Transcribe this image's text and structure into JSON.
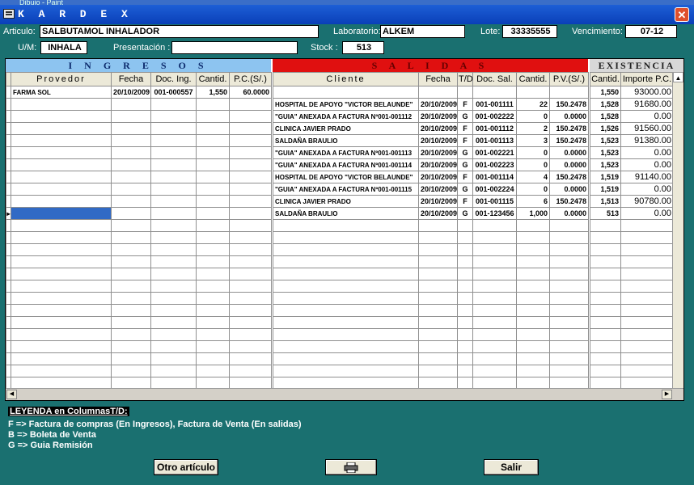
{
  "window": {
    "outer_title": "Dibujo - Paint",
    "title": "K A R D E X",
    "close_glyph": "✕"
  },
  "fields": {
    "articulo_label": "Articulo:",
    "articulo": "SALBUTAMOL INHALADOR",
    "laboratorio_label": "Laboratorio:",
    "laboratorio": "ALKEM",
    "lote_label": "Lote:",
    "lote": "33335555",
    "vencimiento_label": "Vencimiento:",
    "vencimiento": "07-12",
    "um_label": "U/M:",
    "um": "INHALA",
    "presentacion_label": "Presentación :",
    "presentacion": "",
    "stock_label": "Stock :",
    "stock": "513"
  },
  "sections": {
    "ingresos": "I N G R E S O S",
    "salidas": "S A L I D A S",
    "existencia": "EXISTENCIA"
  },
  "columns": {
    "ingresos": [
      "Provedor",
      "Fecha",
      "Doc. Ing.",
      "Cantid.",
      "P.C.(S/.)"
    ],
    "salidas": [
      "Cliente",
      "Fecha",
      "T/D",
      "Doc. Sal.",
      "Cantid.",
      "P.V.(S/.)"
    ],
    "existencia": [
      "Cantid.",
      "Importe P.C."
    ]
  },
  "rows": [
    {
      "ing": [
        "FARMA SOL",
        "20/10/2009",
        "001-000557",
        "1,550",
        "60.0000"
      ],
      "sal": [
        "",
        "",
        "",
        "",
        "",
        ""
      ],
      "exi": [
        "1,550",
        "93000.00"
      ]
    },
    {
      "ing": [
        "",
        "",
        "",
        "",
        ""
      ],
      "sal": [
        "HOSPITAL DE APOYO \"VICTOR BELAUNDE\"",
        "20/10/2009",
        "F",
        "001-001111",
        "22",
        "150.2478"
      ],
      "exi": [
        "1,528",
        "91680.00"
      ]
    },
    {
      "ing": [
        "",
        "",
        "",
        "",
        ""
      ],
      "sal": [
        "\"GUIA\" ANEXADA A FACTURA Nº001-001112",
        "20/10/2009",
        "G",
        "001-002222",
        "0",
        "0.0000"
      ],
      "exi": [
        "1,528",
        "0.00"
      ]
    },
    {
      "ing": [
        "",
        "",
        "",
        "",
        ""
      ],
      "sal": [
        "CLINICA JAVIER PRADO",
        "20/10/2009",
        "F",
        "001-001112",
        "2",
        "150.2478"
      ],
      "exi": [
        "1,526",
        "91560.00"
      ]
    },
    {
      "ing": [
        "",
        "",
        "",
        "",
        ""
      ],
      "sal": [
        "SALDAÑA BRAULIO",
        "20/10/2009",
        "F",
        "001-001113",
        "3",
        "150.2478"
      ],
      "exi": [
        "1,523",
        "91380.00"
      ]
    },
    {
      "ing": [
        "",
        "",
        "",
        "",
        ""
      ],
      "sal": [
        "\"GUIA\" ANEXADA A FACTURA Nº001-001113",
        "20/10/2009",
        "G",
        "001-002221",
        "0",
        "0.0000"
      ],
      "exi": [
        "1,523",
        "0.00"
      ]
    },
    {
      "ing": [
        "",
        "",
        "",
        "",
        ""
      ],
      "sal": [
        "\"GUIA\" ANEXADA A FACTURA Nº001-001114",
        "20/10/2009",
        "G",
        "001-002223",
        "0",
        "0.0000"
      ],
      "exi": [
        "1,523",
        "0.00"
      ]
    },
    {
      "ing": [
        "",
        "",
        "",
        "",
        ""
      ],
      "sal": [
        "HOSPITAL DE APOYO \"VICTOR BELAUNDE\"",
        "20/10/2009",
        "F",
        "001-001114",
        "4",
        "150.2478"
      ],
      "exi": [
        "1,519",
        "91140.00"
      ]
    },
    {
      "ing": [
        "",
        "",
        "",
        "",
        ""
      ],
      "sal": [
        "\"GUIA\" ANEXADA A FACTURA Nº001-001115",
        "20/10/2009",
        "G",
        "001-002224",
        "0",
        "0.0000"
      ],
      "exi": [
        "1,519",
        "0.00"
      ]
    },
    {
      "ing": [
        "",
        "",
        "",
        "",
        ""
      ],
      "sal": [
        "CLINICA JAVIER PRADO",
        "20/10/2009",
        "F",
        "001-001115",
        "6",
        "150.2478"
      ],
      "exi": [
        "1,513",
        "90780.00"
      ]
    },
    {
      "ing": [
        "",
        "",
        "",
        "",
        ""
      ],
      "sal": [
        "SALDAÑA BRAULIO",
        "20/10/2009",
        "G",
        "001-123456",
        "1,000",
        "0.0000"
      ],
      "exi": [
        "513",
        "0.00"
      ]
    }
  ],
  "legend": {
    "title": "LEYENDA en ColumnasT/D:",
    "lines": [
      "F => Factura de compras (En Ingresos), Factura de Venta (En salidas)",
      "B => Boleta de Venta",
      "G => Guia Remisión"
    ]
  },
  "buttons": {
    "otro": "Otro artículo",
    "salir": "Salir"
  },
  "icons": {
    "print": "printer-icon",
    "app": "kardex-app-icon",
    "close": "close-icon"
  }
}
